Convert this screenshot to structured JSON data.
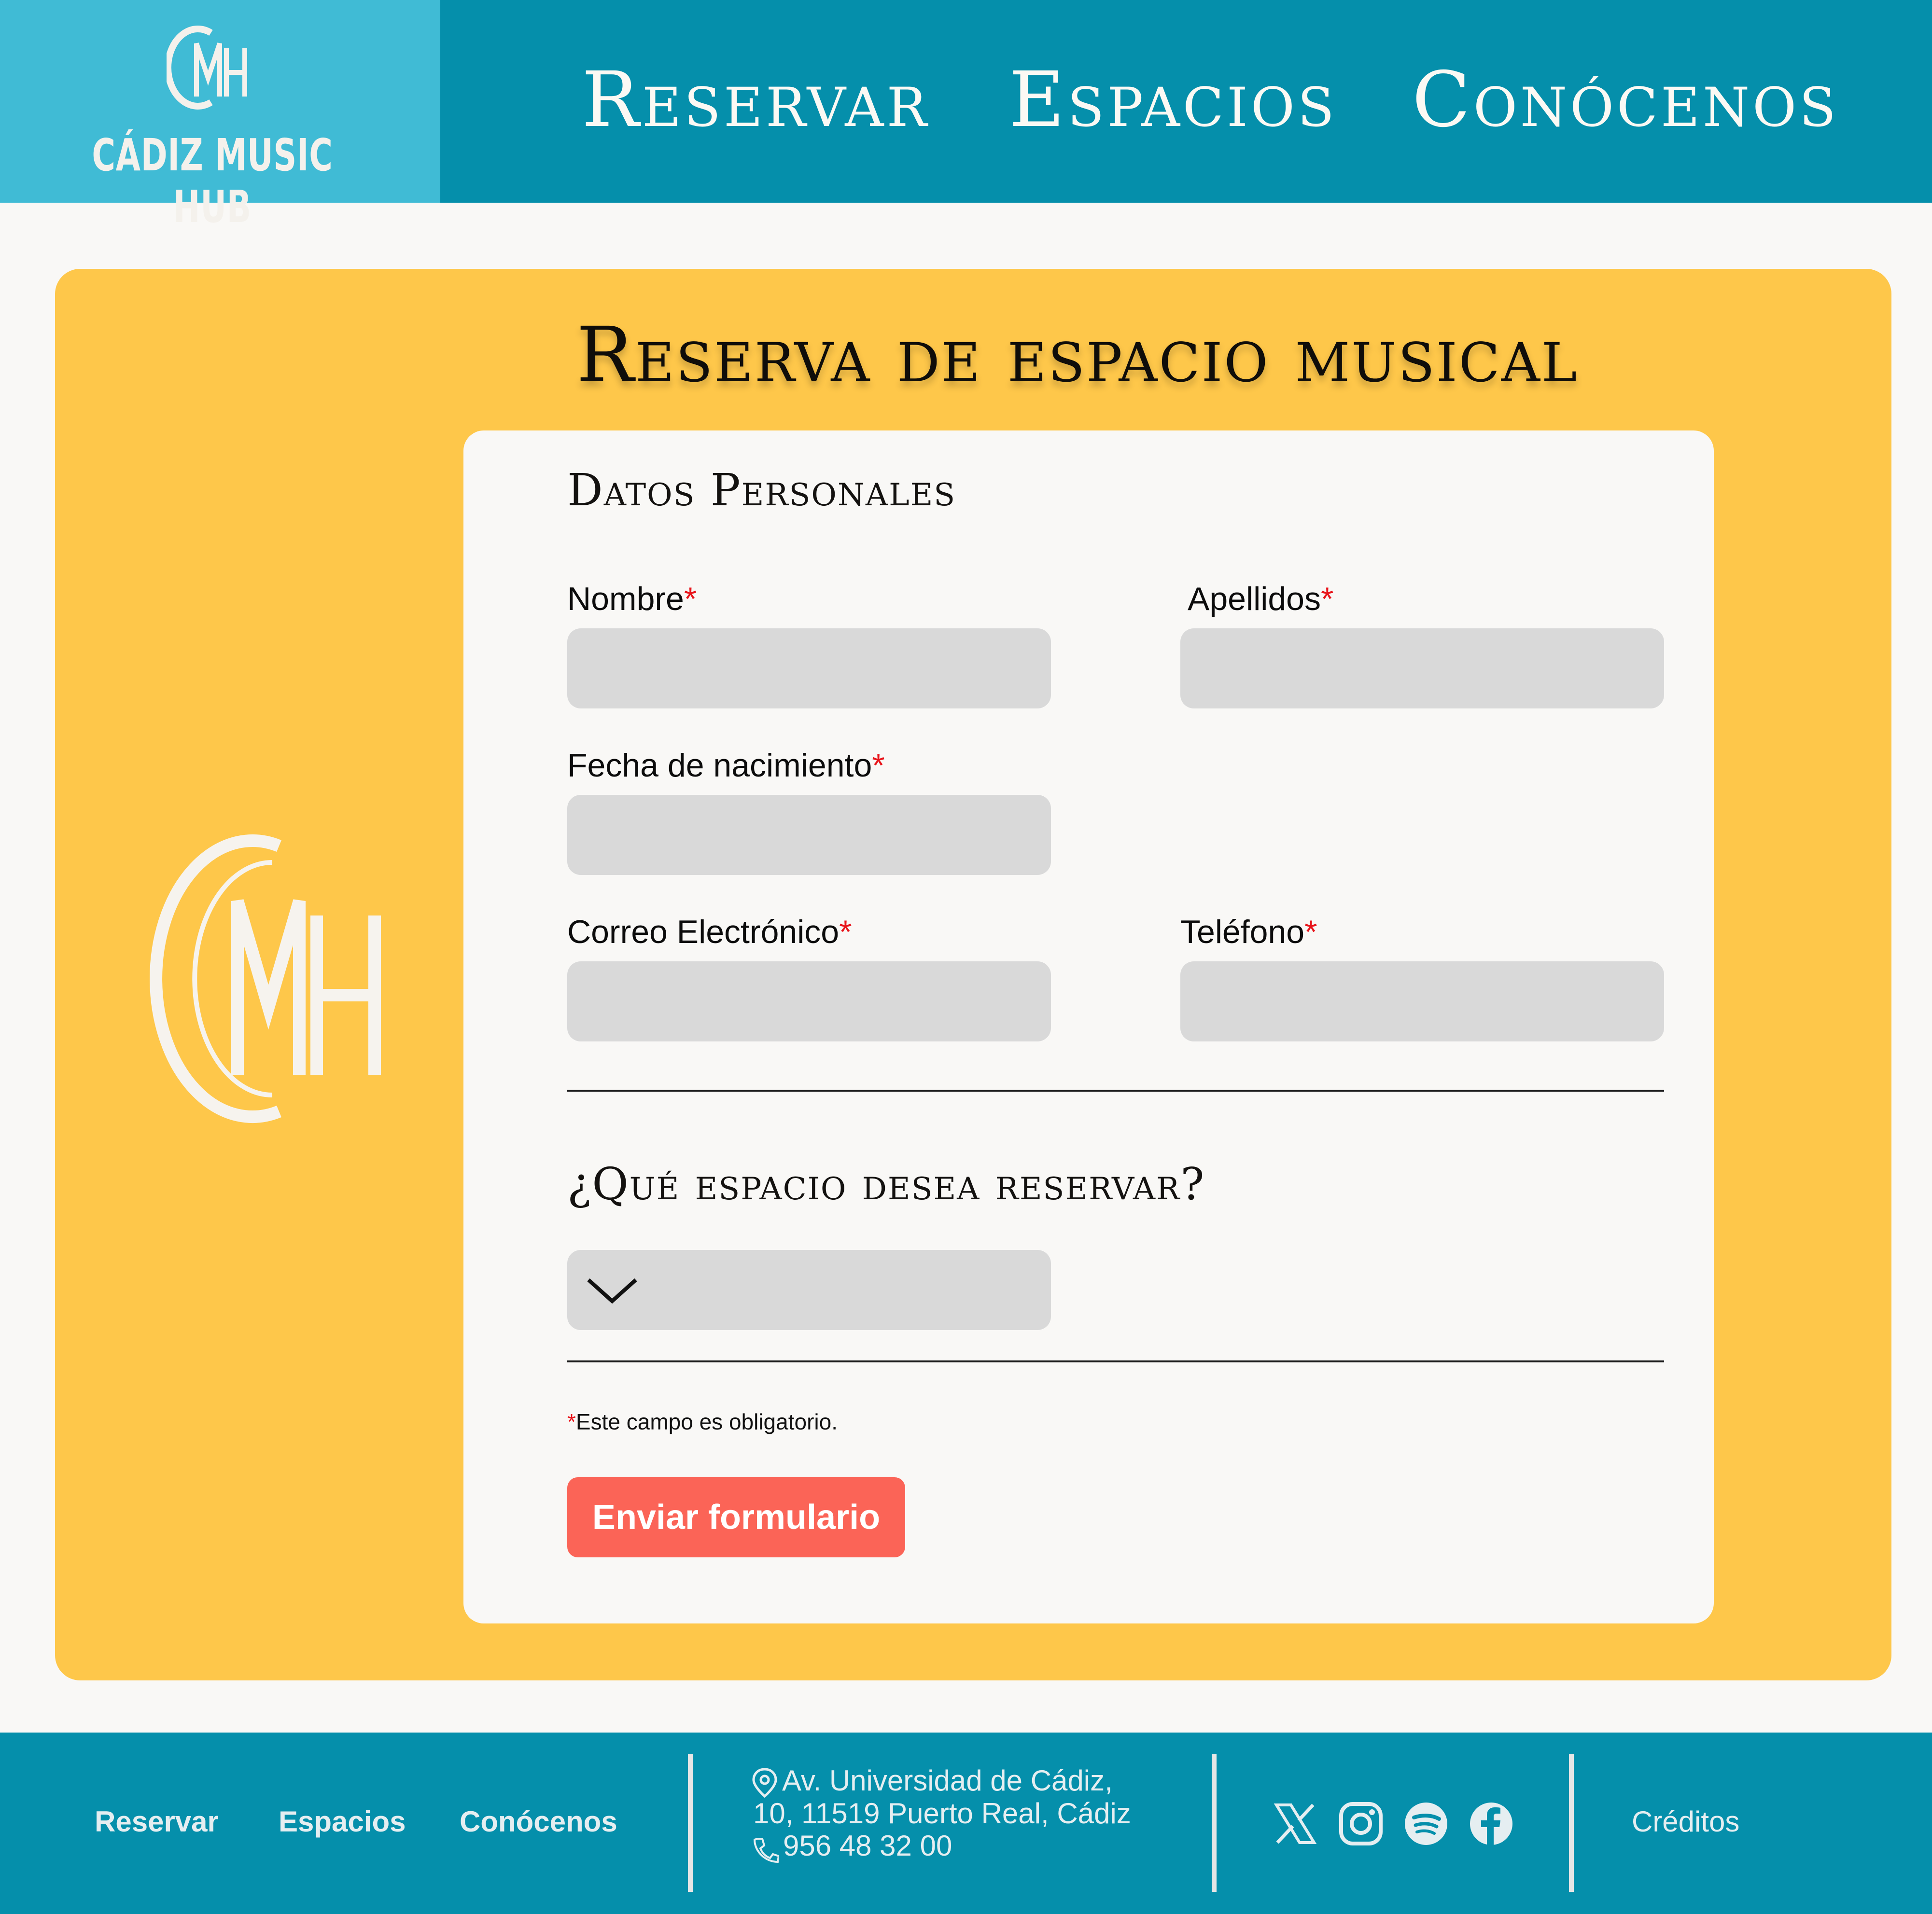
{
  "header": {
    "brand_name": "CÁDIZ MUSIC HUB",
    "brand_mark_letters": "CMH",
    "nav": [
      "Reservar",
      "Espacios",
      "Conócenos"
    ]
  },
  "main": {
    "title": "Reserva de espacio musical",
    "personal_section": "Datos Personales",
    "fields": {
      "nombre": {
        "label": "Nombre",
        "value": ""
      },
      "apellidos": {
        "label": "Apellidos",
        "value": ""
      },
      "fecha": {
        "label": "Fecha de nacimiento",
        "value": ""
      },
      "correo": {
        "label": "Correo Electrónico",
        "value": ""
      },
      "telefono": {
        "label": "Teléfono",
        "value": ""
      }
    },
    "required_mark": "*",
    "space_section": "¿Qué espacio desea reservar?",
    "space_selected": "",
    "required_note": "Este campo es obligatorio.",
    "submit_label": "Enviar formulario"
  },
  "footer": {
    "nav": [
      "Reservar",
      "Espacios",
      "Conócenos"
    ],
    "address_line1": "Av. Universidad de Cádiz,",
    "address_line2": "10, 11519 Puerto Real, Cádiz",
    "phone": "956 48 32 00",
    "social_icons": [
      "x-icon",
      "instagram-icon",
      "spotify-icon",
      "facebook-icon"
    ],
    "credits": "Créditos"
  },
  "colors": {
    "header_bg": "#058fab",
    "brand_bg": "#40bbd5",
    "panel_bg": "#fec74a",
    "card_bg": "#f9f8f6",
    "input_bg": "#d9d9d9",
    "button_bg": "#fb6457",
    "required": "#e8141a"
  }
}
